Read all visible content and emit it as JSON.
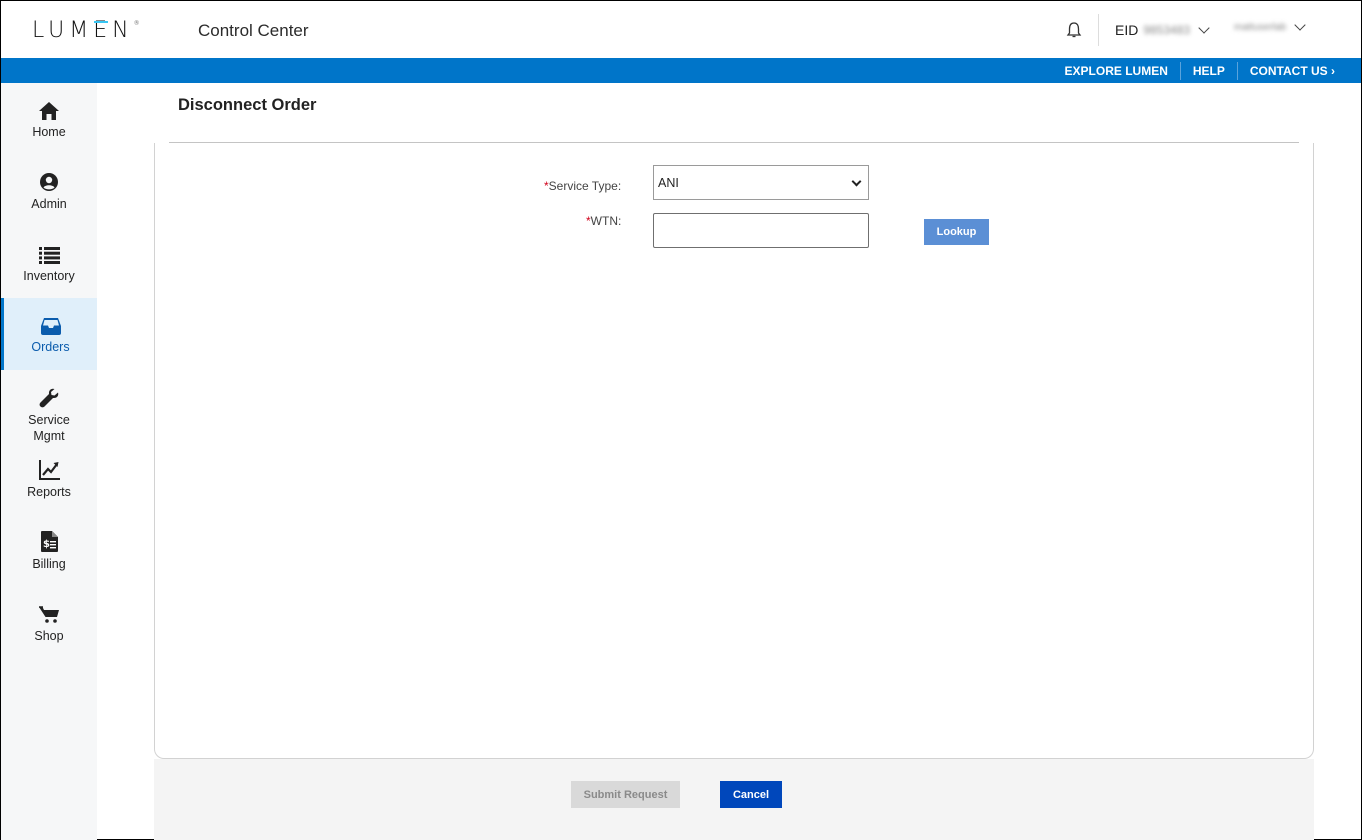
{
  "header": {
    "logo_text": "LUMEN",
    "app_title": "Control Center",
    "eid_label": "EID",
    "eid_value": "9853483",
    "user_name": "mattuserlab",
    "notifications_icon": "bell-icon"
  },
  "top_nav": {
    "links": [
      {
        "label": "EXPLORE LUMEN"
      },
      {
        "label": "HELP"
      },
      {
        "label": "CONTACT US ›"
      }
    ]
  },
  "sidebar": {
    "items": [
      {
        "label": "Home",
        "icon": "home-icon",
        "active": false
      },
      {
        "label": "Admin",
        "icon": "user-circle-icon",
        "active": false
      },
      {
        "label": "Inventory",
        "icon": "list-icon",
        "active": false
      },
      {
        "label": "Orders",
        "icon": "inbox-tray-icon",
        "active": true
      },
      {
        "label": "Service Mgmt",
        "icon": "wrench-icon",
        "active": false
      },
      {
        "label": "Reports",
        "icon": "chart-line-icon",
        "active": false
      },
      {
        "label": "Billing",
        "icon": "invoice-icon",
        "active": false
      },
      {
        "label": "Shop",
        "icon": "cart-icon",
        "active": false
      }
    ]
  },
  "main": {
    "page_title": "Disconnect Order",
    "form": {
      "service_type": {
        "required_mark": "*",
        "label": "Service Type:",
        "selected": "ANI"
      },
      "wtn": {
        "required_mark": "*",
        "label": "WTN:",
        "value": "",
        "placeholder": ""
      },
      "lookup_label": "Lookup"
    },
    "footer": {
      "submit_label": "Submit Request",
      "cancel_label": "Cancel"
    }
  },
  "colors": {
    "brand_blue": "#0075c9",
    "primary_button": "#0047bb",
    "lookup_button": "#5b8fd5",
    "required": "#d0021b"
  }
}
